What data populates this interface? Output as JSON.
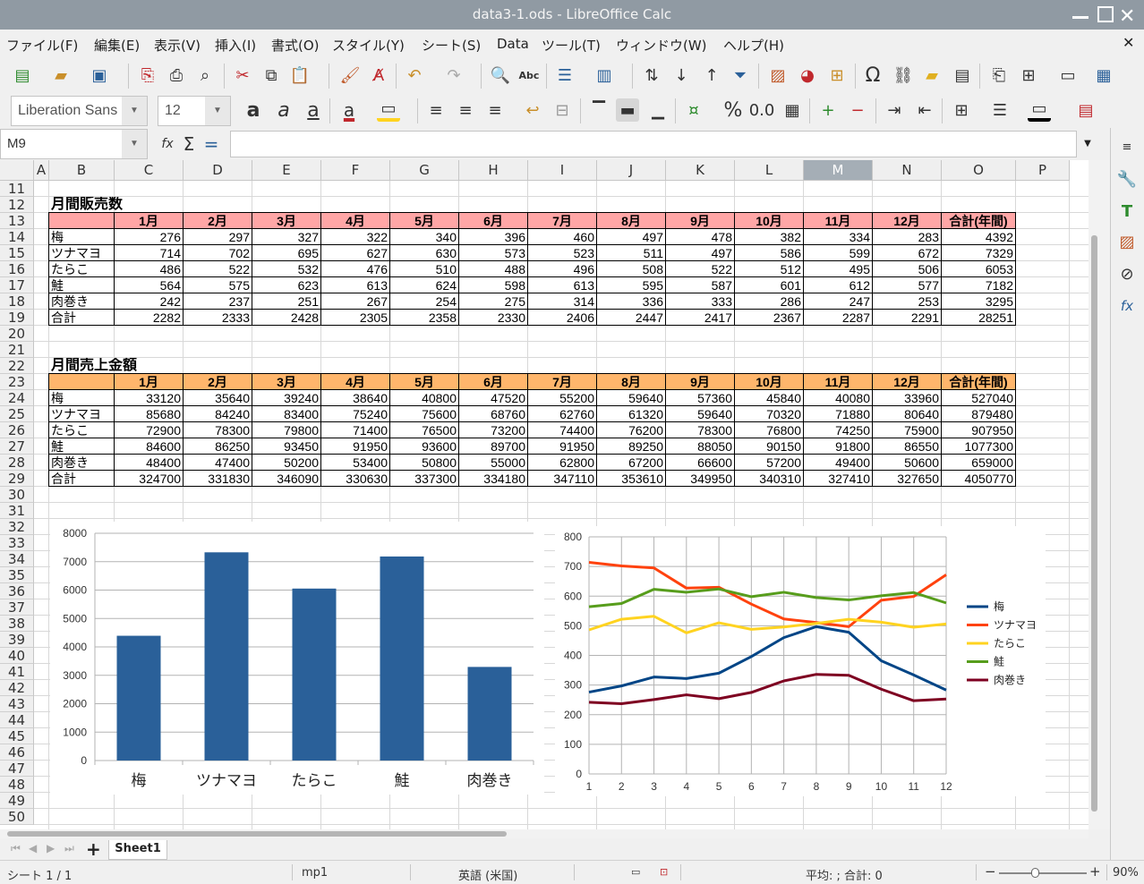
{
  "window": {
    "title": "data3-1.ods - LibreOffice Calc"
  },
  "menu": [
    "ファイル(F)",
    "編集(E)",
    "表示(V)",
    "挿入(I)",
    "書式(O)",
    "スタイル(Y)",
    "シート(S)",
    "Data",
    "ツール(T)",
    "ウィンドウ(W)",
    "ヘルプ(H)"
  ],
  "format": {
    "font_name": "Liberation Sans",
    "font_size": "12"
  },
  "formula": {
    "cell_ref": "M9",
    "content": ""
  },
  "columns": [
    "A",
    "B",
    "C",
    "D",
    "E",
    "F",
    "G",
    "H",
    "I",
    "J",
    "K",
    "L",
    "M",
    "N",
    "O",
    "P"
  ],
  "selected_column": "M",
  "rows": [
    "11",
    "12",
    "13",
    "14",
    "15",
    "16",
    "17",
    "18",
    "19",
    "20",
    "21",
    "22",
    "23",
    "24",
    "25",
    "26",
    "27",
    "28",
    "29",
    "30",
    "31",
    "32",
    "33",
    "34",
    "35",
    "36",
    "37",
    "38",
    "39",
    "40",
    "41",
    "42",
    "43",
    "44",
    "45",
    "46",
    "47",
    "48",
    "49",
    "50"
  ],
  "table1": {
    "title": "月間販売数",
    "headers": [
      "1月",
      "2月",
      "3月",
      "4月",
      "5月",
      "6月",
      "7月",
      "8月",
      "9月",
      "10月",
      "11月",
      "12月",
      "合計(年間)"
    ],
    "rows": [
      {
        "label": "梅",
        "values": [
          "276",
          "297",
          "327",
          "322",
          "340",
          "396",
          "460",
          "497",
          "478",
          "382",
          "334",
          "283",
          "4392"
        ]
      },
      {
        "label": "ツナマヨ",
        "values": [
          "714",
          "702",
          "695",
          "627",
          "630",
          "573",
          "523",
          "511",
          "497",
          "586",
          "599",
          "672",
          "7329"
        ]
      },
      {
        "label": "たらこ",
        "values": [
          "486",
          "522",
          "532",
          "476",
          "510",
          "488",
          "496",
          "508",
          "522",
          "512",
          "495",
          "506",
          "6053"
        ]
      },
      {
        "label": "鮭",
        "values": [
          "564",
          "575",
          "623",
          "613",
          "624",
          "598",
          "613",
          "595",
          "587",
          "601",
          "612",
          "577",
          "7182"
        ]
      },
      {
        "label": "肉巻き",
        "values": [
          "242",
          "237",
          "251",
          "267",
          "254",
          "275",
          "314",
          "336",
          "333",
          "286",
          "247",
          "253",
          "3295"
        ]
      },
      {
        "label": "合計",
        "values": [
          "2282",
          "2333",
          "2428",
          "2305",
          "2358",
          "2330",
          "2406",
          "2447",
          "2417",
          "2367",
          "2287",
          "2291",
          "28251"
        ]
      }
    ]
  },
  "table2": {
    "title": "月間売上金額",
    "headers": [
      "1月",
      "2月",
      "3月",
      "4月",
      "5月",
      "6月",
      "7月",
      "8月",
      "9月",
      "10月",
      "11月",
      "12月",
      "合計(年間)"
    ],
    "rows": [
      {
        "label": "梅",
        "values": [
          "33120",
          "35640",
          "39240",
          "38640",
          "40800",
          "47520",
          "55200",
          "59640",
          "57360",
          "45840",
          "40080",
          "33960",
          "527040"
        ]
      },
      {
        "label": "ツナマヨ",
        "values": [
          "85680",
          "84240",
          "83400",
          "75240",
          "75600",
          "68760",
          "62760",
          "61320",
          "59640",
          "70320",
          "71880",
          "80640",
          "879480"
        ]
      },
      {
        "label": "たらこ",
        "values": [
          "72900",
          "78300",
          "79800",
          "71400",
          "76500",
          "73200",
          "74400",
          "76200",
          "78300",
          "76800",
          "74250",
          "75900",
          "907950"
        ]
      },
      {
        "label": "鮭",
        "values": [
          "84600",
          "86250",
          "93450",
          "91950",
          "93600",
          "89700",
          "91950",
          "89250",
          "88050",
          "90150",
          "91800",
          "86550",
          "1077300"
        ]
      },
      {
        "label": "肉巻き",
        "values": [
          "48400",
          "47400",
          "50200",
          "53400",
          "50800",
          "55000",
          "62800",
          "67200",
          "66600",
          "57200",
          "49400",
          "50600",
          "659000"
        ]
      },
      {
        "label": "合計",
        "values": [
          "324700",
          "331830",
          "346090",
          "330630",
          "337300",
          "334180",
          "347110",
          "353610",
          "349950",
          "340310",
          "327410",
          "327650",
          "4050770"
        ]
      }
    ]
  },
  "chart_data": [
    {
      "type": "bar",
      "categories": [
        "梅",
        "ツナマヨ",
        "たらこ",
        "鮭",
        "肉巻き"
      ],
      "values": [
        4392,
        7329,
        6053,
        7182,
        3295
      ],
      "ylim": [
        0,
        8000
      ],
      "yticks": [
        "0",
        "1000",
        "2000",
        "3000",
        "4000",
        "5000",
        "6000",
        "7000",
        "8000"
      ],
      "color": "#2a6099",
      "grid": true
    },
    {
      "type": "line",
      "x": [
        1,
        2,
        3,
        4,
        5,
        6,
        7,
        8,
        9,
        10,
        11,
        12
      ],
      "xticks": [
        "1",
        "2",
        "3",
        "4",
        "5",
        "6",
        "7",
        "8",
        "9",
        "10",
        "11",
        "12"
      ],
      "ylim": [
        0,
        800
      ],
      "yticks": [
        "0",
        "100",
        "200",
        "300",
        "400",
        "500",
        "600",
        "700",
        "800"
      ],
      "grid": true,
      "legend": "right",
      "series": [
        {
          "name": "梅",
          "color": "#004586",
          "values": [
            276,
            297,
            327,
            322,
            340,
            396,
            460,
            497,
            478,
            382,
            334,
            283
          ]
        },
        {
          "name": "ツナマヨ",
          "color": "#ff420e",
          "values": [
            714,
            702,
            695,
            627,
            630,
            573,
            523,
            511,
            497,
            586,
            599,
            672
          ]
        },
        {
          "name": "たらこ",
          "color": "#ffd320",
          "values": [
            486,
            522,
            532,
            476,
            510,
            488,
            496,
            508,
            522,
            512,
            495,
            506
          ]
        },
        {
          "name": "鮭",
          "color": "#579d1c",
          "values": [
            564,
            575,
            623,
            613,
            624,
            598,
            613,
            595,
            587,
            601,
            612,
            577
          ]
        },
        {
          "name": "肉巻き",
          "color": "#7e0021",
          "values": [
            242,
            237,
            251,
            267,
            254,
            275,
            314,
            336,
            333,
            286,
            247,
            253
          ]
        }
      ]
    }
  ],
  "colors": {
    "header1": "#ffa6a6",
    "header2": "#ffb66c",
    "selected_col": "#a5aeb6"
  },
  "sheet_tab": "Sheet1",
  "status": {
    "sheet": "シート 1 / 1",
    "style": "mp1",
    "language": "英語 (米国)",
    "summary": "平均: ; 合計: 0",
    "zoom": "90%"
  }
}
